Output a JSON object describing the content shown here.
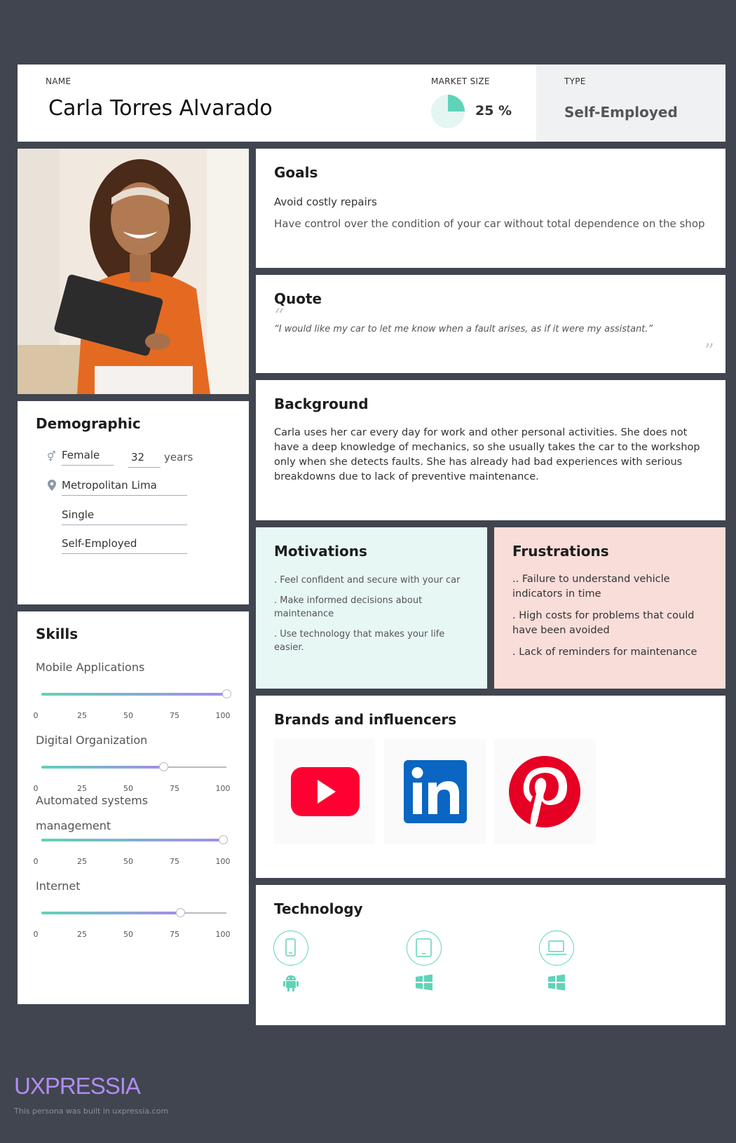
{
  "header": {
    "name_label": "NAME",
    "name": "Carla Torres Alvarado",
    "market_size_label": "MARKET SIZE",
    "market_size_value": "25 %",
    "market_size_fraction": 0.25,
    "type_label": "TYPE",
    "type_value": "Self-Employed"
  },
  "demographic": {
    "title": "Demographic",
    "gender": "Female",
    "age": "32",
    "age_unit": "years",
    "location": "Metropolitan Lima",
    "marital_status": "Single",
    "occupation": "Self-Employed"
  },
  "skills": {
    "title": "Skills",
    "ticks": [
      "0",
      "25",
      "50",
      "75",
      "100"
    ],
    "items": [
      {
        "name": "Mobile Applications",
        "value": 100
      },
      {
        "name": "Digital Organization",
        "value": 66
      },
      {
        "name_line1": "Automated systems",
        "name_line2": "management",
        "value": 98
      },
      {
        "name": "Internet",
        "value": 75
      }
    ]
  },
  "goals": {
    "title": "Goals",
    "items": [
      "Avoid costly repairs",
      "Have control over the condition of your car without total dependence on the shop"
    ]
  },
  "quote": {
    "title": "Quote",
    "text": "“I would like my car to let me know when a fault arises, as if it were my assistant.”"
  },
  "background": {
    "title": "Background",
    "text": "Carla uses her car every day for work and other personal activities. She does not have a deep knowledge of mechanics, so she usually takes the car to the workshop only when she detects faults. She has already had bad experiences with serious breakdowns due to lack of preventive maintenance."
  },
  "motivations": {
    "title": "Motivations",
    "items": [
      ". Feel confident and secure with your car",
      ". Make informed decisions about maintenance",
      ". Use technology that makes your life easier."
    ]
  },
  "frustrations": {
    "title": "Frustrations",
    "items": [
      ".. Failure to understand vehicle indicators in time",
      ". High costs for problems that could have been avoided",
      ". Lack of reminders for maintenance"
    ]
  },
  "brands": {
    "title": "Brands and influencers",
    "logos": [
      "youtube-logo",
      "linkedin-logo",
      "pinterest-logo"
    ]
  },
  "technology": {
    "title": "Technology",
    "devices": [
      {
        "device": "smartphone-icon",
        "os": "android-icon"
      },
      {
        "device": "tablet-icon",
        "os": "windows-icon"
      },
      {
        "device": "laptop-icon",
        "os": "windows-icon"
      }
    ]
  },
  "colors": {
    "background": "#40454f",
    "accent_teal": "#5fd3b8",
    "accent_purple": "#a48de8",
    "motivations_bg": "#e7f7f3",
    "frustrations_bg": "#f8ddd9",
    "logo": "#b18cf0"
  },
  "footer": {
    "logo": "UXPRESSIA",
    "note": "This persona was built in uxpressia.com"
  }
}
